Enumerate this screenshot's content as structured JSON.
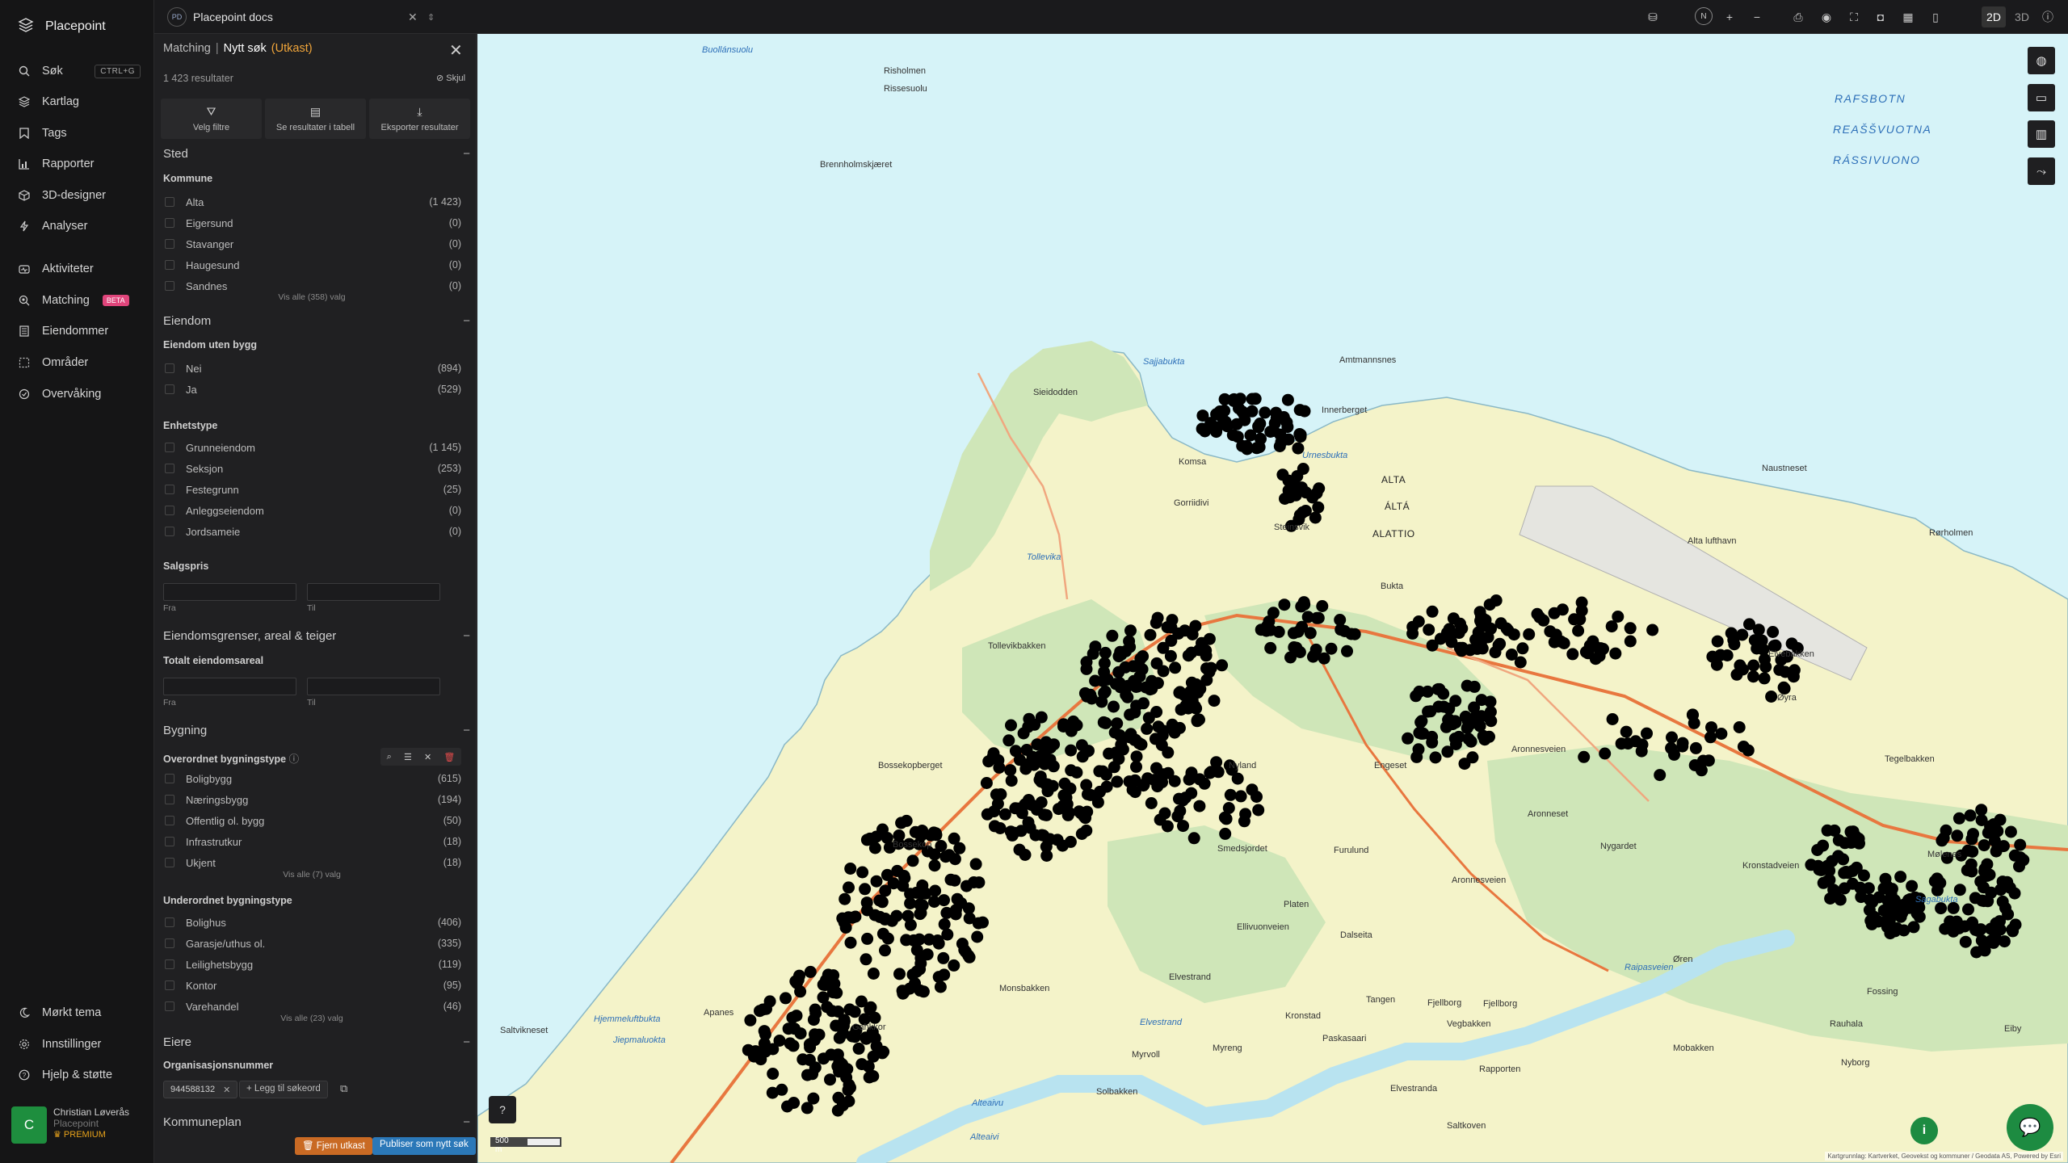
{
  "app": {
    "name": "Placepoint"
  },
  "nav": {
    "items": [
      {
        "label": "Søk",
        "icon": "search-icon",
        "shortcut": "CTRL+G"
      },
      {
        "label": "Kartlag",
        "icon": "layers-icon"
      },
      {
        "label": "Tags",
        "icon": "bookmark-icon"
      },
      {
        "label": "Rapporter",
        "icon": "chart-icon"
      },
      {
        "label": "3D-designer",
        "icon": "cube-icon"
      },
      {
        "label": "Analyser",
        "icon": "bolt-icon"
      },
      {
        "label": "Aktiviteter",
        "icon": "activity-icon"
      },
      {
        "label": "Matching",
        "icon": "matching-icon",
        "badge": "BETA"
      },
      {
        "label": "Eiendommer",
        "icon": "building-icon"
      },
      {
        "label": "Områder",
        "icon": "area-icon"
      },
      {
        "label": "Overvåking",
        "icon": "monitor-icon"
      }
    ],
    "bottom": [
      {
        "label": "Mørkt tema",
        "icon": "moon-icon"
      },
      {
        "label": "Innstillinger",
        "icon": "gear-icon"
      },
      {
        "label": "Hjelp & støtte",
        "icon": "help-icon"
      }
    ],
    "user": {
      "initial": "C",
      "name": "Christian Løverås",
      "org": "Placepoint",
      "plan": "PREMIUM"
    }
  },
  "topbar": {
    "workspace_badge": "PD",
    "workspace_name": "Placepoint docs",
    "compass": "N",
    "mode_2d": "2D",
    "mode_3d": "3D",
    "active_mode": "2D"
  },
  "panel": {
    "breadcrumb": {
      "section": "Matching",
      "sep": "|",
      "title": "Nytt søk",
      "state": "(Utkast)"
    },
    "results": "1 423 resultater",
    "hide": "Skjul",
    "actions": [
      "Velg filtre",
      "Se resultater i tabell",
      "Eksporter resultater"
    ],
    "sections": {
      "sted": {
        "title": "Sted",
        "kommune_label": "Kommune",
        "options": [
          {
            "label": "Alta",
            "count": "(1 423)"
          },
          {
            "label": "Eigersund",
            "count": "(0)"
          },
          {
            "label": "Stavanger",
            "count": "(0)"
          },
          {
            "label": "Haugesund",
            "count": "(0)"
          },
          {
            "label": "Sandnes",
            "count": "(0)"
          }
        ],
        "show_all": "Vis alle (358) valg"
      },
      "eiendom": {
        "title": "Eiendom",
        "uten_bygg_label": "Eiendom uten bygg",
        "uten_bygg": [
          {
            "label": "Nei",
            "count": "(894)"
          },
          {
            "label": "Ja",
            "count": "(529)"
          }
        ],
        "enhetstype_label": "Enhetstype",
        "enhetstype": [
          {
            "label": "Grunneiendom",
            "count": "(1 145)"
          },
          {
            "label": "Seksjon",
            "count": "(253)"
          },
          {
            "label": "Festegrunn",
            "count": "(25)"
          },
          {
            "label": "Anleggseiendom",
            "count": "(0)"
          },
          {
            "label": "Jordsameie",
            "count": "(0)"
          }
        ],
        "salgspris_label": "Salgspris",
        "from": "Fra",
        "to": "Til"
      },
      "grenser": {
        "title": "Eiendomsgrenser, areal & teiger",
        "areal_label": "Totalt eiendomsareal",
        "from": "Fra",
        "to": "Til"
      },
      "bygning": {
        "title": "Bygning",
        "overordnet_label": "Overordnet bygningstype",
        "overordnet": [
          {
            "label": "Boligbygg",
            "count": "(615)"
          },
          {
            "label": "Næringsbygg",
            "count": "(194)"
          },
          {
            "label": "Offentlig ol. bygg",
            "count": "(50)"
          },
          {
            "label": "Infrastrutkur",
            "count": "(18)"
          },
          {
            "label": "Ukjent",
            "count": "(18)"
          }
        ],
        "overordnet_show_all": "Vis alle (7) valg",
        "underordnet_label": "Underordnet bygningstype",
        "underordnet": [
          {
            "label": "Bolighus",
            "count": "(406)"
          },
          {
            "label": "Garasje/uthus ol.",
            "count": "(335)"
          },
          {
            "label": "Leilighetsbygg",
            "count": "(119)"
          },
          {
            "label": "Kontor",
            "count": "(95)"
          },
          {
            "label": "Varehandel",
            "count": "(46)"
          }
        ],
        "underordnet_show_all": "Vis alle (23) valg"
      },
      "eiere": {
        "title": "Eiere",
        "org_label": "Organisasjonsnummer",
        "chip": "944588132",
        "add_keyword": "Legg til søkeord"
      },
      "kommuneplan": {
        "title": "Kommuneplan"
      }
    },
    "footer": {
      "remove_draft": "Fjern utkast",
      "publish": "Publiser som nytt søk"
    }
  },
  "map": {
    "labels": [
      "Buollánsuolu",
      "Risholmen",
      "Rissesuolu",
      "Brennholmskjæret",
      "RAFSBOTN",
      "REAŠŠVUOTNA",
      "RÁSSIVUONO",
      "Amtmannsnes",
      "Innerberget",
      "Sieidodden",
      "Sajjabukta",
      "Komsa",
      "Gorriidivi",
      "Urnesbukta",
      "ALTA",
      "ÁLTÁ",
      "ALATTIO",
      "Naustneset",
      "Alta lufthavn",
      "Rørholmen",
      "Tollevika",
      "Tollevikbakken",
      "Steinsvik",
      "Bukta",
      "Elvebakken",
      "Øyra",
      "Bossekopberget",
      "Bossekop",
      "Nyland",
      "Engeset",
      "Aronnesveien",
      "Tegelbakken",
      "Mølenes",
      "Furulund",
      "Smedsjordet",
      "Ellivuonveien",
      "Aronnesveien",
      "Platen",
      "Dalseita",
      "Elvestrand",
      "Saltvikneset",
      "Hjemmeluftbukta",
      "Jiepmaluokta",
      "Apanes",
      "Monsbakken",
      "Elvestrand",
      "Myrvoll",
      "Myreng",
      "Kronstad",
      "Tangen",
      "Fjellborg",
      "Vegbakken",
      "Paskasaari",
      "Raipasveien",
      "Rapporten",
      "Elvestranda",
      "Saltkoven",
      "Alteaivu",
      "Alteaivi",
      "Nyborg",
      "Fossing",
      "Rauhala",
      "Mobakken",
      "Nygardet",
      "Fjellborg",
      "Gahkkor",
      "Solbakken",
      "Eiby",
      "Øren",
      "Kronstadveien",
      "Sagabukta",
      "Aronneset"
    ],
    "scale": "500 m",
    "attribution": "Kartgrunnlag: Kartverket, Geovekst og kommuner / Geodata AS, Powered by Esri",
    "colors": {
      "sea": "#d6f3f8",
      "land": "#f4f3c9",
      "forest": "#cfe6b8",
      "road": "#e8773f",
      "dots": "#000000"
    },
    "tools": [
      "globe-icon",
      "ruler-icon",
      "stats-icon",
      "route-icon"
    ]
  }
}
